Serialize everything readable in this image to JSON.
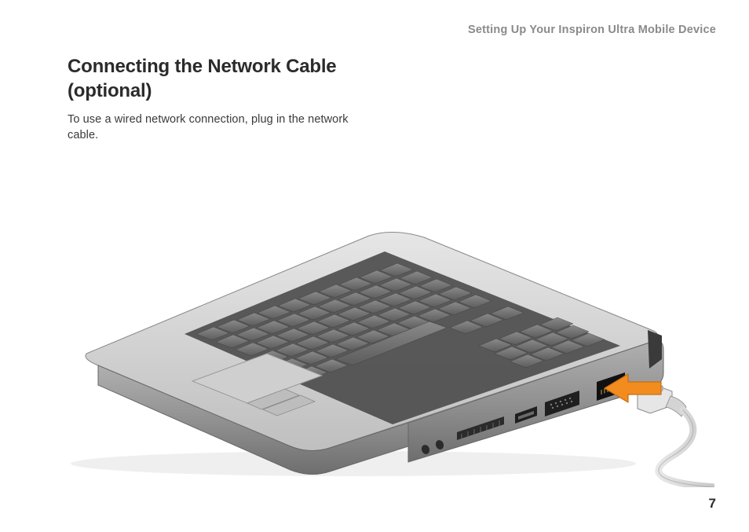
{
  "header": {
    "running_head": "Setting Up Your Inspiron Ultra Mobile Device"
  },
  "section": {
    "title": "Connecting the Network Cable (optional)",
    "body": "To use a wired network connection, plug in the network cable."
  },
  "page_number": "7",
  "illustration": {
    "alt": "Diagram of a laptop shown from an angle, keyboard and touchpad visible on top, with an orange arrow indicating a network (RJ-45) cable being plugged into the network port on the right side of the device. Other side ports (audio jacks, USB, VGA) are also visible.",
    "arrow_color": "#f28c1f",
    "laptop_body_color_light": "#dcdcdc",
    "laptop_body_color_dark": "#9a9a9a",
    "keyboard_key_color": "#707070",
    "cable_color": "#d8d8d8"
  }
}
